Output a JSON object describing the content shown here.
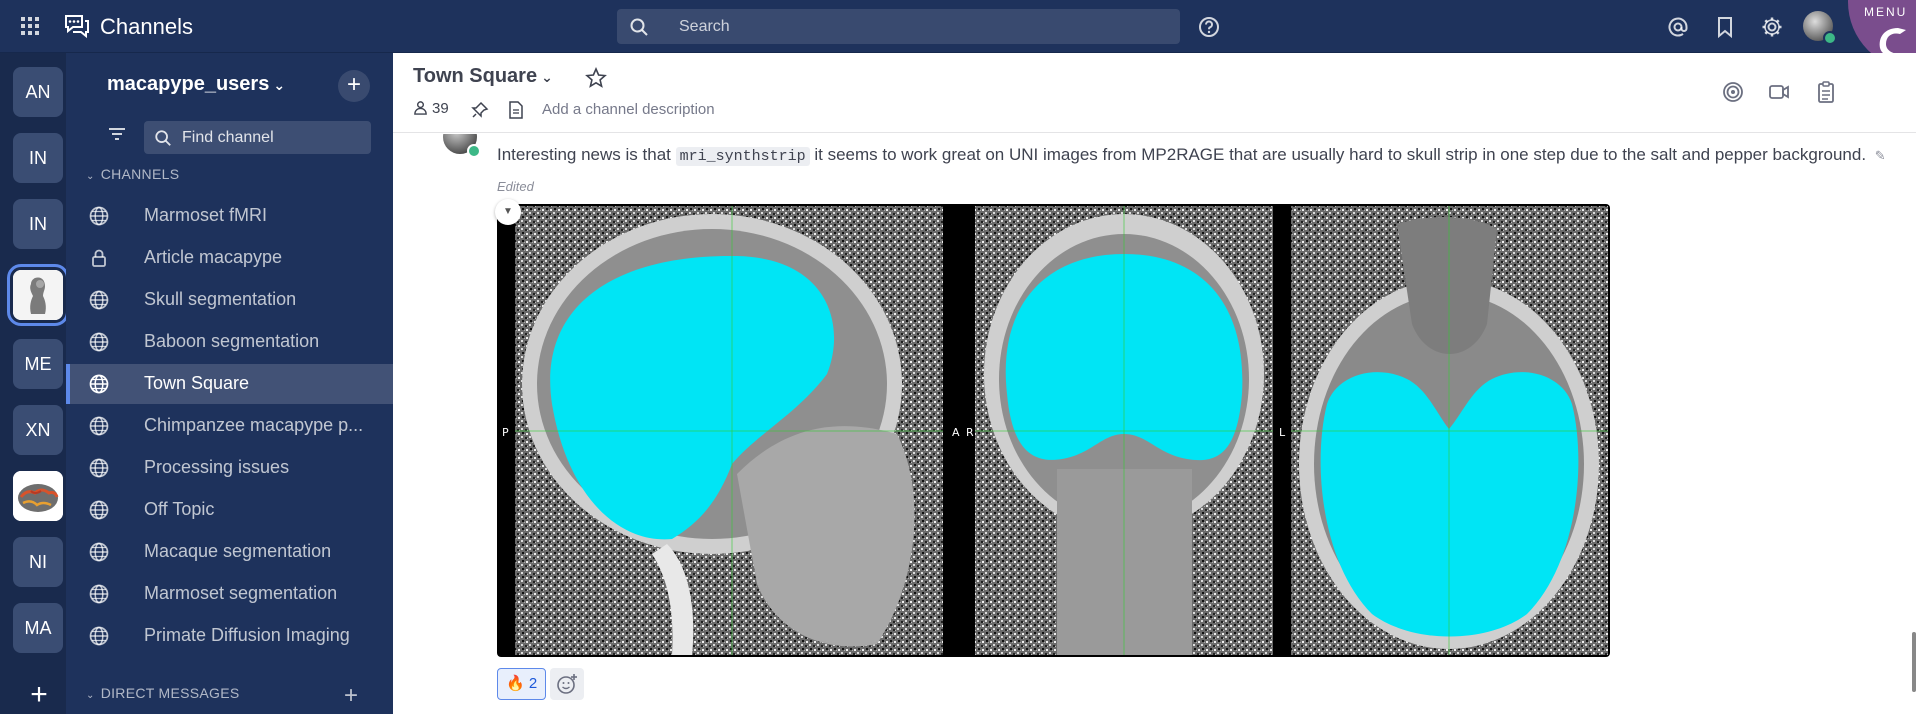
{
  "topbar": {
    "app_title": "Channels",
    "search_placeholder": "Search",
    "icons": [
      "grid-icon",
      "channels-app-icon",
      "search-icon",
      "help-icon",
      "mention-icon",
      "bookmark-icon",
      "settings-icon"
    ],
    "menu_label": "MENU"
  },
  "teams": [
    "AN",
    "IN",
    "IN",
    "",
    "ME",
    "XN",
    "",
    "NI",
    "MA"
  ],
  "sidebar": {
    "team_name": "macapype_users",
    "find_placeholder": "Find channel",
    "channels_header": "CHANNELS",
    "dm_header": "DIRECT MESSAGES",
    "channels": [
      {
        "label": "Marmoset fMRI",
        "icon": "globe-icon"
      },
      {
        "label": "Article macapype",
        "icon": "lock-icon"
      },
      {
        "label": "Skull segmentation",
        "icon": "globe-icon"
      },
      {
        "label": "Baboon segmentation",
        "icon": "globe-icon"
      },
      {
        "label": "Town Square",
        "icon": "globe-icon",
        "active": true
      },
      {
        "label": "Chimpanzee macapype p...",
        "icon": "globe-icon"
      },
      {
        "label": "Processing issues",
        "icon": "globe-icon"
      },
      {
        "label": "Off Topic",
        "icon": "globe-icon"
      },
      {
        "label": "Macaque segmentation",
        "icon": "globe-icon"
      },
      {
        "label": "Marmoset segmentation",
        "icon": "globe-icon"
      },
      {
        "label": "Primate Diffusion Imaging",
        "icon": "globe-icon"
      }
    ]
  },
  "channel": {
    "title": "Town Square",
    "member_count": "39",
    "description_placeholder": "Add a channel description"
  },
  "post": {
    "text_before": "Interesting news is that ",
    "code": "mri_synthstrip",
    "text_after": " it seems to work great on UNI images from MP2RAGE that are usually hard to skull strip in one step due to the salt and pepper background.",
    "edited": "Edited",
    "reaction_emoji": "🔥",
    "reaction_count": "2",
    "image_labels": {
      "sag_left": "P",
      "sag_right": "A",
      "cor_left": "R",
      "cor_right": "L"
    }
  },
  "colors": {
    "sidebar": "#1e325c",
    "accent": "#5d89ea",
    "status_online": "#3db887",
    "mask": "#00e5f5"
  }
}
